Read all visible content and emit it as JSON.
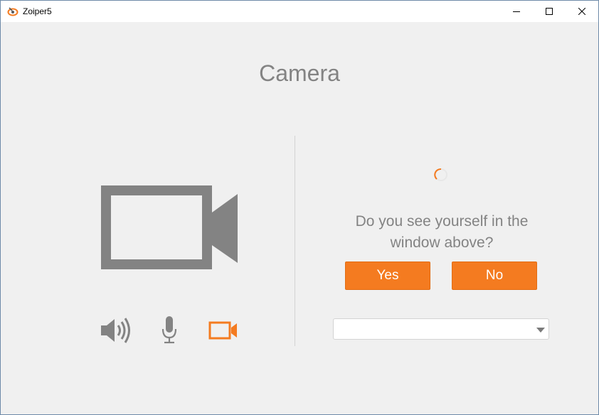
{
  "window": {
    "title": "Zoiper5",
    "app_icon": "zoiper-logo-icon",
    "controls": [
      "minimize-icon",
      "maximize-icon",
      "close-icon"
    ]
  },
  "page": {
    "heading": "Camera"
  },
  "preview": {
    "question": "Do you see yourself in the window above?"
  },
  "buttons": {
    "yes_label": "Yes",
    "no_label": "No"
  },
  "camera_select": {
    "selected": ""
  },
  "tabs": [
    {
      "icon": "speaker-icon",
      "active": false
    },
    {
      "icon": "microphone-icon",
      "active": false
    },
    {
      "icon": "camera-icon",
      "active": true
    }
  ],
  "colors": {
    "accent": "#f47b20",
    "icon_gray": "#838383",
    "text_gray": "#838383",
    "background": "#f0f0f0"
  }
}
